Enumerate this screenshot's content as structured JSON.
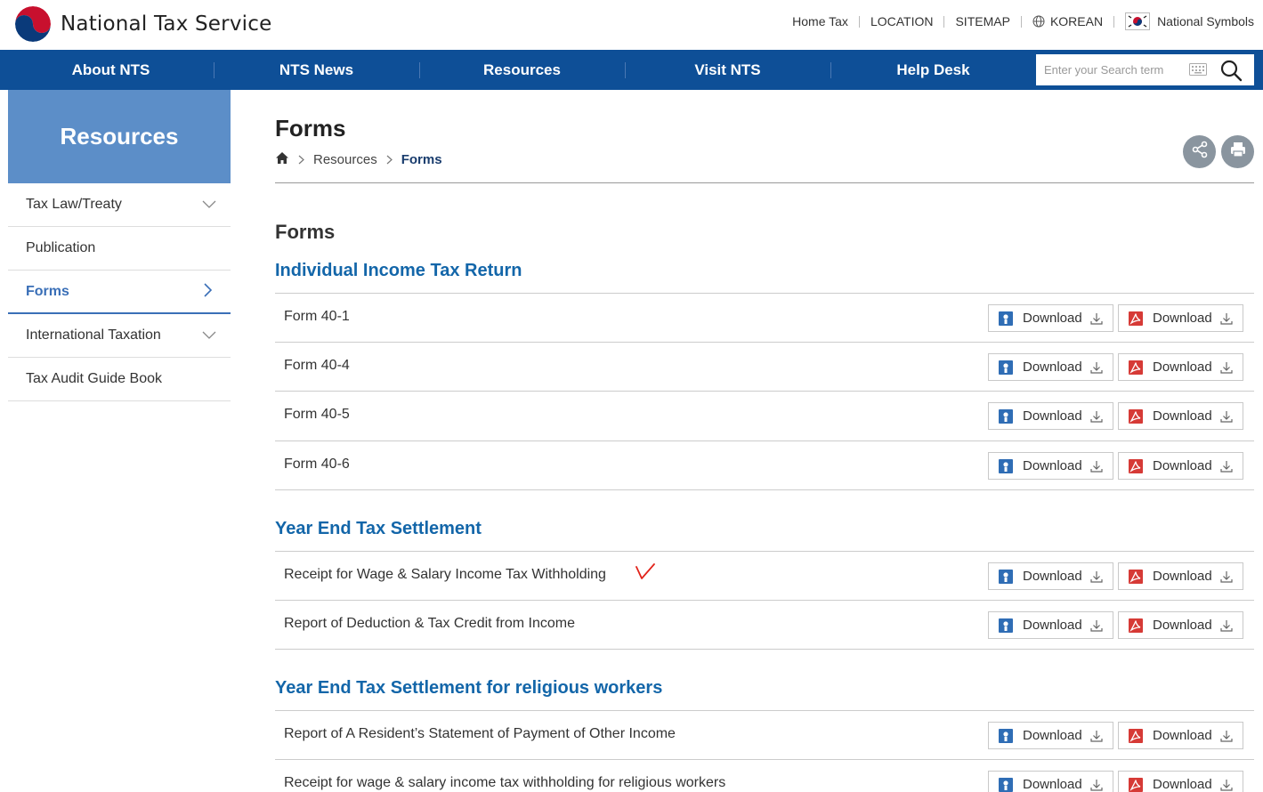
{
  "header": {
    "logo_text": "National Tax Service",
    "util_links": [
      "Home Tax",
      "LOCATION",
      "SITEMAP",
      "KOREAN",
      "National Symbols"
    ]
  },
  "nav": {
    "items": [
      "About NTS",
      "NTS News",
      "Resources",
      "Visit NTS",
      "Help Desk"
    ],
    "search_placeholder": "Enter your Search term"
  },
  "sidebar": {
    "title": "Resources",
    "items": [
      {
        "label": "Tax Law/Treaty",
        "expandable": true,
        "active": false
      },
      {
        "label": "Publication",
        "expandable": false,
        "active": false
      },
      {
        "label": "Forms",
        "expandable": true,
        "active": true
      },
      {
        "label": "International Taxation",
        "expandable": true,
        "active": false
      },
      {
        "label": "Tax Audit Guide Book",
        "expandable": false,
        "active": false
      }
    ]
  },
  "page": {
    "title": "Forms",
    "breadcrumb": [
      "Resources",
      "Forms"
    ],
    "section_label": "Forms",
    "download_label": "Download"
  },
  "groups": [
    {
      "title": "Individual Income Tax Return",
      "rows": [
        "Form 40-1",
        "Form 40-4",
        "Form 40-5",
        "Form 40-6"
      ]
    },
    {
      "title": "Year End Tax Settlement",
      "rows": [
        "Receipt for Wage & Salary Income Tax Withholding",
        "Report of Deduction & Tax Credit from Income"
      ]
    },
    {
      "title": "Year End Tax Settlement for religious workers",
      "rows": [
        "Report of A Resident’s Statement of Payment of Other Income",
        "Receipt for wage & salary income tax withholding for religious workers"
      ]
    }
  ],
  "colors": {
    "nav_bg": "#0e4f97",
    "sidebar_head": "#5c8ec8",
    "group_title": "#1366a9",
    "hwp_icon": "#2f6db5",
    "pdf_icon": "#d63a36"
  }
}
